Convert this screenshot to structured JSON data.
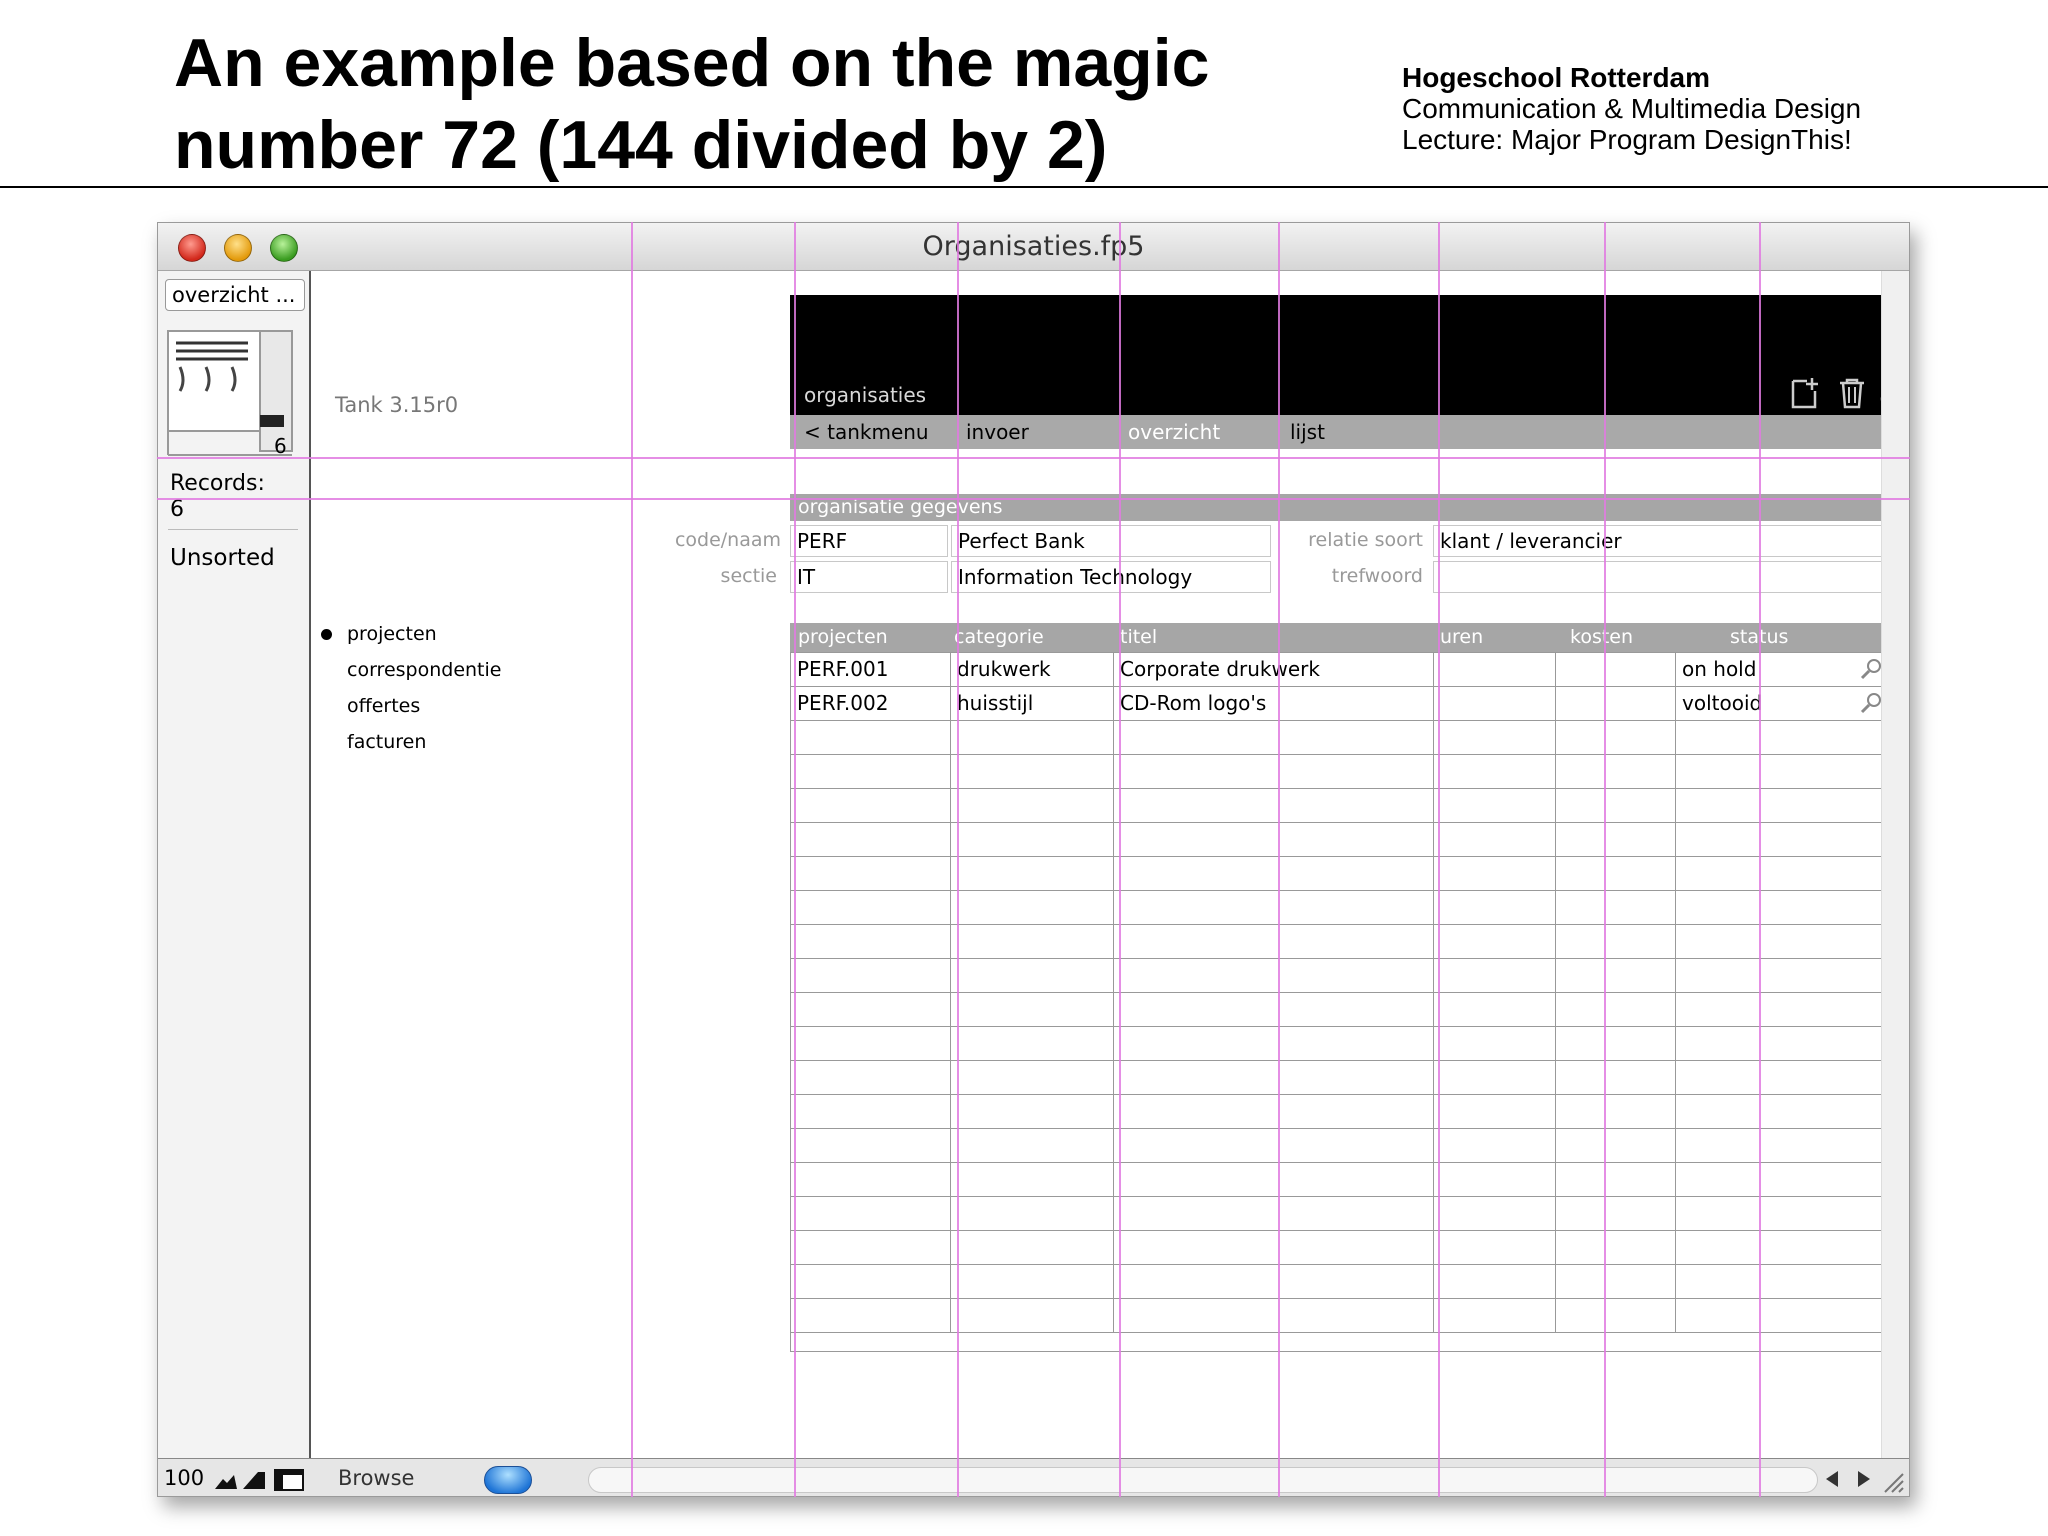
{
  "slide": {
    "title_line1": "An example based on the magic",
    "title_line2": "number 72 (144 divided by 2)",
    "org": "Hogeschool Rotterdam",
    "dept": "Communication & Multimedia Design",
    "lecture": "Lecture: Major Program DesignThis!"
  },
  "window": {
    "title": "Organisaties.fp5"
  },
  "status_area": {
    "layout_popup": "overzicht ...",
    "book_page": "6",
    "records_label": "Records:",
    "records_count": "6",
    "sort_status": "Unsorted"
  },
  "layout": {
    "version": "Tank 3.15r0",
    "banner_label": "organisaties",
    "banner_icons": [
      "new-record-icon",
      "trash-icon",
      "binoculars-icon"
    ],
    "nav": [
      "< tankmenu",
      "invoer",
      "overzicht",
      "lijst"
    ],
    "section_title": "organisatie gegevens",
    "fields": {
      "code_naam_label": "code/naam",
      "code": "PERF",
      "naam": "Perfect Bank",
      "relatie_label": "relatie soort",
      "relatie": "klant / leverancier",
      "sectie_label": "sectie",
      "sectie_code": "IT",
      "sectie_naam": "Information Technology",
      "trefwoord_label": "trefwoord",
      "trefwoord": ""
    },
    "portal_nav": [
      "projecten",
      "correspondentie",
      "offertes",
      "facturen"
    ],
    "portal_headers": [
      "projecten",
      "categorie",
      "titel",
      "uren",
      "kosten",
      "status"
    ],
    "portal_rows": [
      {
        "project": "PERF.001",
        "categorie": "drukwerk",
        "titel": "Corporate drukwerk",
        "uren": "",
        "kosten": "",
        "status": "on hold"
      },
      {
        "project": "PERF.002",
        "categorie": "huisstijl",
        "titel": "CD-Rom logo's",
        "uren": "",
        "kosten": "",
        "status": "voltooid"
      }
    ]
  },
  "bottom_bar": {
    "zoom": "100",
    "mode": "Browse"
  },
  "colors": {
    "grid_line": "#e07ae0",
    "banner": "#000000",
    "bar": "#a6a6a6"
  }
}
